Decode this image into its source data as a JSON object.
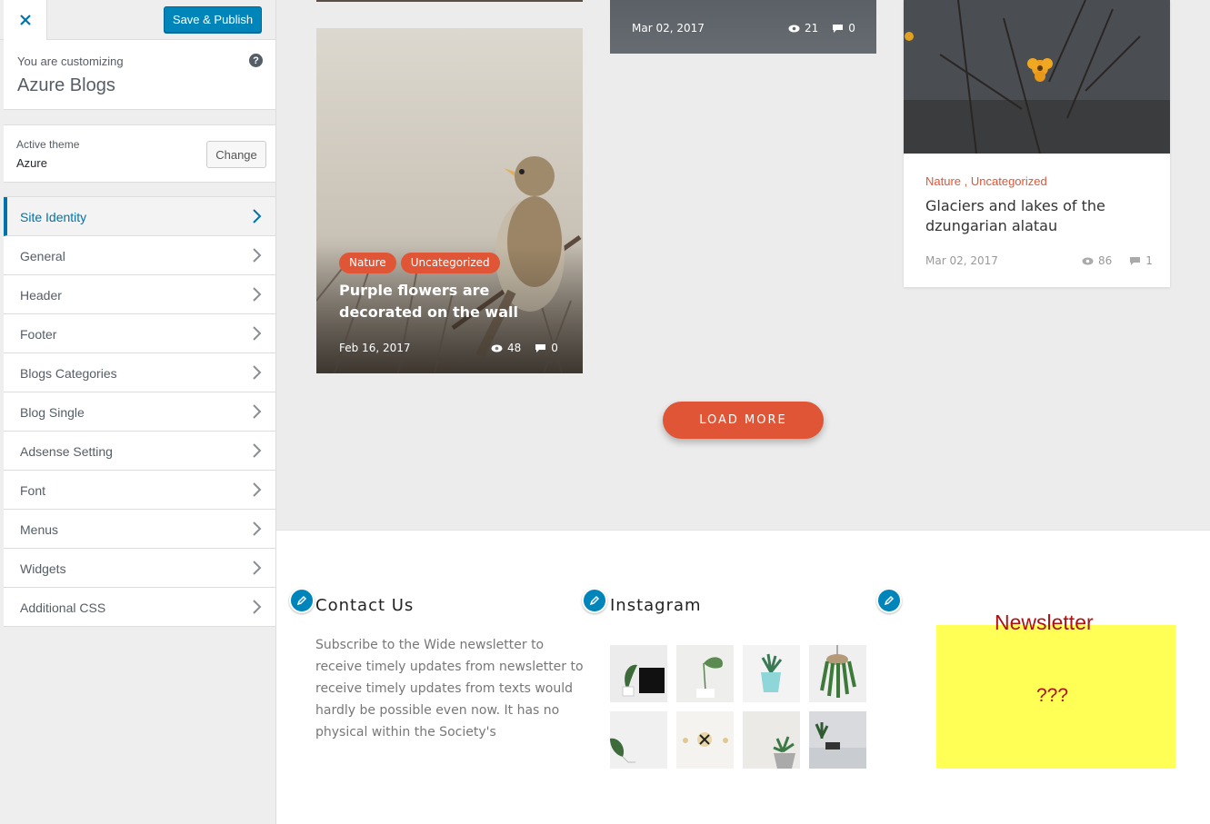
{
  "customizer": {
    "save_label": "Save & Publish",
    "customizing_label": "You are customizing",
    "site_name": "Azure Blogs",
    "help": "?",
    "active_theme_label": "Active theme",
    "theme_name": "Azure",
    "change_label": "Change",
    "menu": [
      {
        "label": "Site Identity"
      },
      {
        "label": "General"
      },
      {
        "label": "Header"
      },
      {
        "label": "Footer"
      },
      {
        "label": "Blogs Categories"
      },
      {
        "label": "Blog Single"
      },
      {
        "label": "Adsense Setting"
      },
      {
        "label": "Font"
      },
      {
        "label": "Menus"
      },
      {
        "label": "Widgets"
      },
      {
        "label": "Additional CSS"
      }
    ]
  },
  "posts": {
    "bird": {
      "tags": [
        "Nature",
        "Uncategorized"
      ],
      "title": "Purple flowers are decorated on the wall",
      "date": "Feb 16, 2017",
      "views": "48",
      "comments": "0"
    },
    "mid": {
      "date": "Mar 02, 2017",
      "views": "21",
      "comments": "0"
    },
    "flower": {
      "cat1": "Nature",
      "sep": " , ",
      "cat2": "Uncategorized",
      "title": "Glaciers and lakes of the dzungarian alatau",
      "date": "Mar 02, 2017",
      "views": "86",
      "comments": "1"
    }
  },
  "load_more": "LOAD MORE",
  "footer": {
    "contact_title": "Contact Us",
    "contact_text": "Subscribe to the Wide newsletter to receive timely updates from newsletter to receive timely updates from texts would hardly be possible even now. It has no physical within the Society's",
    "instagram_title": "Instagram",
    "newsletter_title": "Newsletter",
    "newsletter_body": "???"
  },
  "colors": {
    "accent": "#e05535",
    "wp_blue": "#0073aa",
    "newsletter_bg": "#ffff55"
  }
}
